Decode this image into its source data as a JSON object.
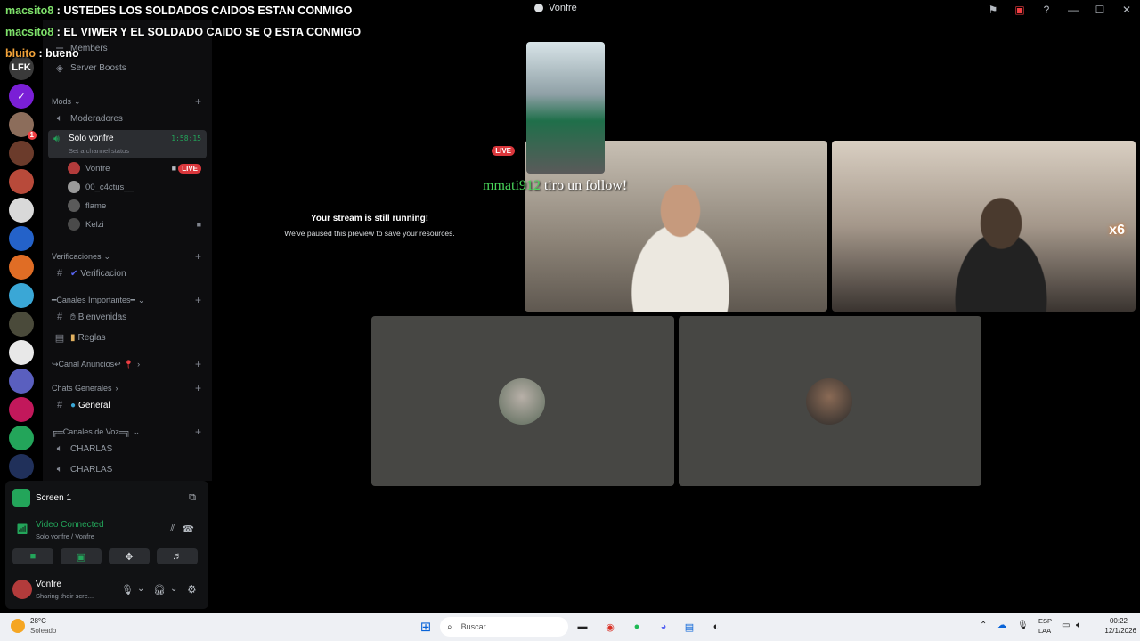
{
  "window": {
    "title": "Vonfre"
  },
  "chat_overlay": [
    {
      "user": "macsito8",
      "sep": " : ",
      "text": "USTEDES LOS SOLDADOS CAIDOS ESTAN CONMIGO",
      "color": "#7ee06a"
    },
    {
      "user": "macsito8",
      "sep": " : ",
      "text": "EL VIWER Y EL SOLDADO CAIDO SE Q ESTA CONMIGO",
      "color": "#7ee06a"
    },
    {
      "user": "bluito",
      "sep": " : ",
      "text": "bueno",
      "color": "#f2a33a"
    }
  ],
  "servers": [
    {
      "label": "LFK",
      "color": "#3a3a3a"
    },
    {
      "label": "✓",
      "color": "#7a1fd6"
    },
    {
      "label": "",
      "color": "#8c6d5b",
      "badge": "1"
    },
    {
      "label": "",
      "color": "#6b3b2b"
    },
    {
      "label": "",
      "color": "#b84a3a"
    },
    {
      "label": "",
      "color": "#d9d9d9"
    },
    {
      "label": "",
      "color": "#2462c9"
    },
    {
      "label": "",
      "color": "#e06d25"
    },
    {
      "label": "",
      "color": "#3aa7d6"
    },
    {
      "label": "",
      "color": "#4a4a3a"
    },
    {
      "label": "",
      "color": "#e8e8e8"
    },
    {
      "label": "",
      "color": "#5a5fbf"
    },
    {
      "label": "",
      "color": "#c2185b"
    },
    {
      "label": "",
      "color": "#23a55a"
    },
    {
      "label": "",
      "color": "#20305a"
    }
  ],
  "sidebar": {
    "members": "Members",
    "server_boosts": "Server Boosts",
    "cat_mods": "Mods",
    "ch_moderadores": "Moderadores",
    "ch_solo_vonfre": "Solo vonfre",
    "solo_vonfre_timer": "1:58:15",
    "channel_status": "Set a channel status",
    "voice_users": [
      {
        "name": "Vonfre",
        "live": "LIVE",
        "color": "#b23b3b"
      },
      {
        "name": "00_c4ctus__",
        "color": "#9a9a9a"
      },
      {
        "name": "flame",
        "color": "#5a5a5a"
      },
      {
        "name": "Kelzi",
        "color": "#4a4a4a"
      }
    ],
    "cat_verificaciones": "Verificaciones",
    "ch_verificacion": "Verificacion",
    "cat_importantes": "━Canales Importantes━",
    "ch_bienvenidas": "Bienvenidas",
    "ch_reglas": "Reglas",
    "cat_anuncios": "↪Canal Anuncios↩",
    "cat_chats": "Chats Generales",
    "ch_general": "General",
    "cat_voz": "╔═Canales de Voz═╗",
    "ch_charlas_1": "CHARLAS",
    "ch_charlas_2": "CHARLAS"
  },
  "panel": {
    "screen_label": "Screen 1",
    "video_connected": "Video Connected",
    "video_sub": "Solo vonfre / Vonfre",
    "user_name": "Vonfre",
    "user_status": "Sharing their scre..."
  },
  "stage": {
    "live_badge": "LIVE",
    "paused_title": "Your stream is still running!",
    "paused_sub": "We've paused this preview to save your resources.",
    "follow_user": "mmati912",
    "follow_text": " tiro un follow!",
    "combo": "x6"
  },
  "taskbar": {
    "temperature": "28°C",
    "weather": "Soleado",
    "search_placeholder": "Buscar",
    "lang_1": "ESP",
    "lang_2": "LAA",
    "time": "00:22",
    "date": "12/1/2026"
  }
}
